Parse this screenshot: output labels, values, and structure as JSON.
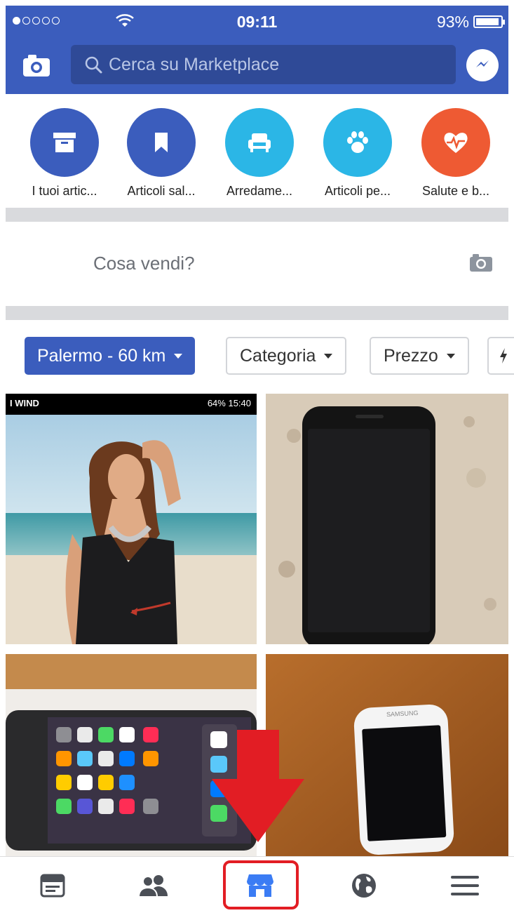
{
  "status_bar": {
    "time": "09:11",
    "battery": "93%"
  },
  "search": {
    "placeholder": "Cerca su Marketplace"
  },
  "categories": [
    {
      "label": "I tuoi artic...",
      "icon": "archive-icon",
      "color": "#3b5dbd"
    },
    {
      "label": "Articoli sal...",
      "icon": "bookmark-icon",
      "color": "#3b5dbd"
    },
    {
      "label": "Arredame...",
      "icon": "armchair-icon",
      "color": "#2bb6e6"
    },
    {
      "label": "Articoli pe...",
      "icon": "paw-icon",
      "color": "#2bb6e6"
    },
    {
      "label": "Salute e b...",
      "icon": "heart-pulse-icon",
      "color": "#ee5a33"
    }
  ],
  "sell": {
    "prompt": "Cosa vendi?"
  },
  "filters": [
    {
      "label": "Palermo - 60 km",
      "active": true
    },
    {
      "label": "Categoria",
      "active": false
    },
    {
      "label": "Prezzo",
      "active": false
    }
  ],
  "listing_1": {
    "status_left": "I WIND",
    "status_right": "64% 15:40"
  },
  "listing_4": {
    "brand": "SAMSUNG"
  },
  "tabs": [
    {
      "name": "news-feed-icon"
    },
    {
      "name": "friends-icon"
    },
    {
      "name": "marketplace-icon"
    },
    {
      "name": "globe-icon"
    },
    {
      "name": "menu-icon"
    }
  ],
  "colors": {
    "brand": "#3b5dbd",
    "annotation": "#e21d24"
  }
}
